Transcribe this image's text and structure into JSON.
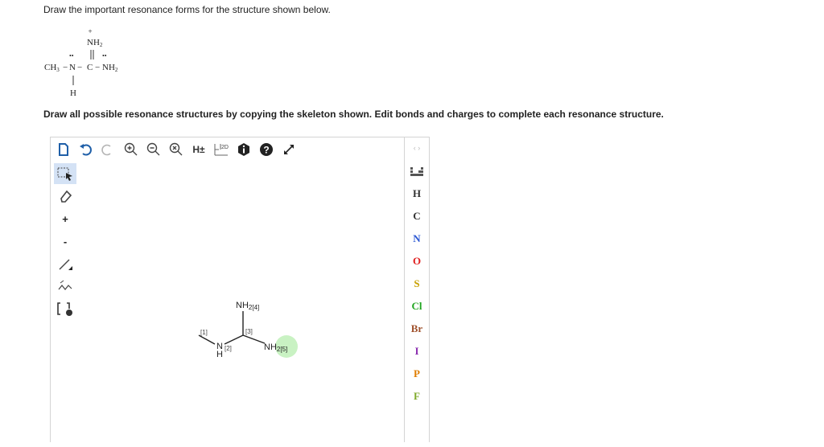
{
  "question": {
    "prompt": "Draw the important resonance forms for the structure shown below.",
    "instruction": "Draw all possible resonance structures by copying the skeleton shown. Edit bonds and charges to complete each resonance structure."
  },
  "given_structure": {
    "plus": "+",
    "top_group": "NH",
    "top_sub": "2",
    "left_dots": "••",
    "right_dots": "••",
    "methyl": "CH",
    "methyl_sub": "3",
    "bond_label_1": "−",
    "nitrogen": "N",
    "bond_label_2": "−",
    "carbon": "C",
    "bond_label_3": "−",
    "right_group": "NH",
    "right_sub": "2",
    "bottom_h": "H"
  },
  "toolbar": {
    "h_toggle": "H±",
    "view_2d": "2D",
    "plus_label": "+",
    "minus_label": "-"
  },
  "elements": [
    "H",
    "C",
    "N",
    "O",
    "S",
    "Cl",
    "Br",
    "I",
    "P",
    "F"
  ],
  "element_colors": {
    "H": "#333333",
    "C": "#333333",
    "N": "#2a57d3",
    "O": "#e02020",
    "S": "#c8a000",
    "Cl": "#21a521",
    "Br": "#a0522d",
    "I": "#8b2fb0",
    "P": "#e07d00",
    "F": "#7faa2a"
  },
  "canvas_molecule": {
    "nh2_top": "NH",
    "nh2_top_sub": "2",
    "nh2_top_idx": "[4]",
    "idx1": "[1]",
    "n_label": "N",
    "h_label": "H",
    "idx2": "[2]",
    "idx3": "[3]",
    "nh2_right": "NH",
    "nh2_right_sub": "2",
    "nh2_right_idx": "[5]"
  },
  "colors": {
    "accent": "#1f5fa8",
    "highlight": "#c9f2c3"
  }
}
